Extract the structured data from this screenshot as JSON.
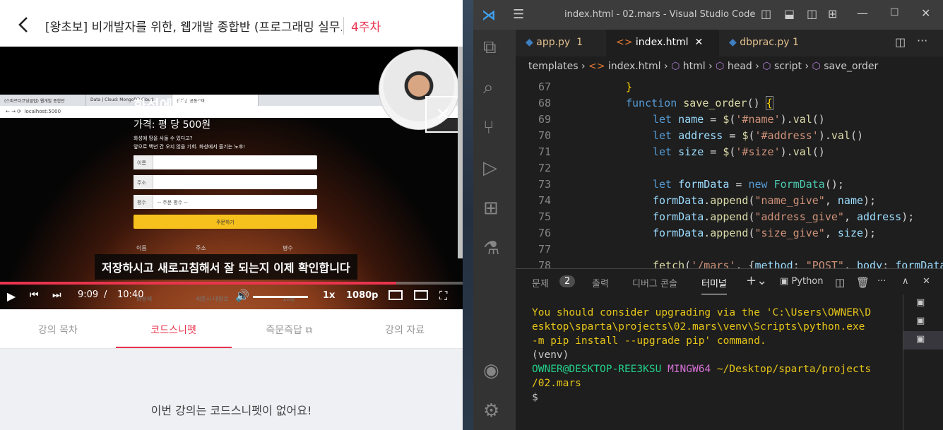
{
  "course": {
    "title": "[왕초보] 비개발자를 위한, 웹개발 종합반 (프로그래밍 실무...",
    "week": "4주차"
  },
  "browser": {
    "tabs": [
      "(스파르타코딩클럽) 웹개발 종합반",
      "Data | Cloud: MongoDB Cloud",
      "선착순 공동구매"
    ],
    "address": "localhost:5000"
  },
  "site": {
    "title": "화성에 땅 사놓기!",
    "price": "가격: 평 당 500원",
    "desc1": "화성에 땅을 사둘 수 있다고?",
    "desc2": "앞으로 백년 간 오지 않을 기회. 화성에서 즐기는 노후!",
    "fields": [
      {
        "label": "이름",
        "value": ""
      },
      {
        "label": "주소",
        "value": ""
      },
      {
        "label": "평수",
        "value": "-- 주문 평수 --"
      }
    ],
    "order_button": "주문하기",
    "table_headers": [
      "이름",
      "주소",
      "평수"
    ],
    "table_row": [
      "화성제",
      "세종시 대왕로",
      "10평"
    ]
  },
  "video": {
    "subtitle": "저장하시고 새로고침해서 잘 되는지 이제 확인합니다",
    "current_time": "9:09",
    "separator": "/",
    "duration": "10:40",
    "progress": 0.857,
    "speed": "1x",
    "quality": "1080p"
  },
  "lecture_tabs": [
    "강의 목차",
    "코드스니펫",
    "즉문즉답",
    "강의 자료"
  ],
  "empty_message": "이번 강의는 코드스니펫이 없어요!",
  "vscode": {
    "window_title": "index.html - 02.mars - Visual Studio Code",
    "tabs": [
      {
        "name": "app.py",
        "badge": "1"
      },
      {
        "name": "index.html",
        "badge": ""
      },
      {
        "name": "dbprac.py",
        "badge": "1"
      }
    ],
    "breadcrumbs": [
      "templates",
      "index.html",
      "html",
      "head",
      "script",
      "save_order"
    ],
    "line_numbers": [
      "67",
      "68",
      "69",
      "70",
      "71",
      "72",
      "73",
      "74",
      "75",
      "76",
      "77",
      "78"
    ],
    "panel": {
      "tabs": [
        "문제",
        "출력",
        "디버그 콘솔",
        "터미널"
      ],
      "problems_count": "2",
      "shell": "Python"
    },
    "terminal": {
      "line1": "You should consider upgrading via the 'C:\\Users\\OWNER\\D",
      "line2": "esktop\\sparta\\projects\\02.mars\\venv\\Scripts\\python.exe",
      "line3": " -m pip install --upgrade pip' command.",
      "line4": "(venv)",
      "user": "OWNER@DESKTOP-REE3KSU",
      "env": "MINGW64",
      "path1": "~/Desktop/sparta/projects",
      "path2": "/02.mars",
      "prompt": "$"
    }
  },
  "colors": {
    "accent": "#e8344e",
    "order_button": "#f7c11d",
    "terminal_warning": "#e5c419"
  }
}
